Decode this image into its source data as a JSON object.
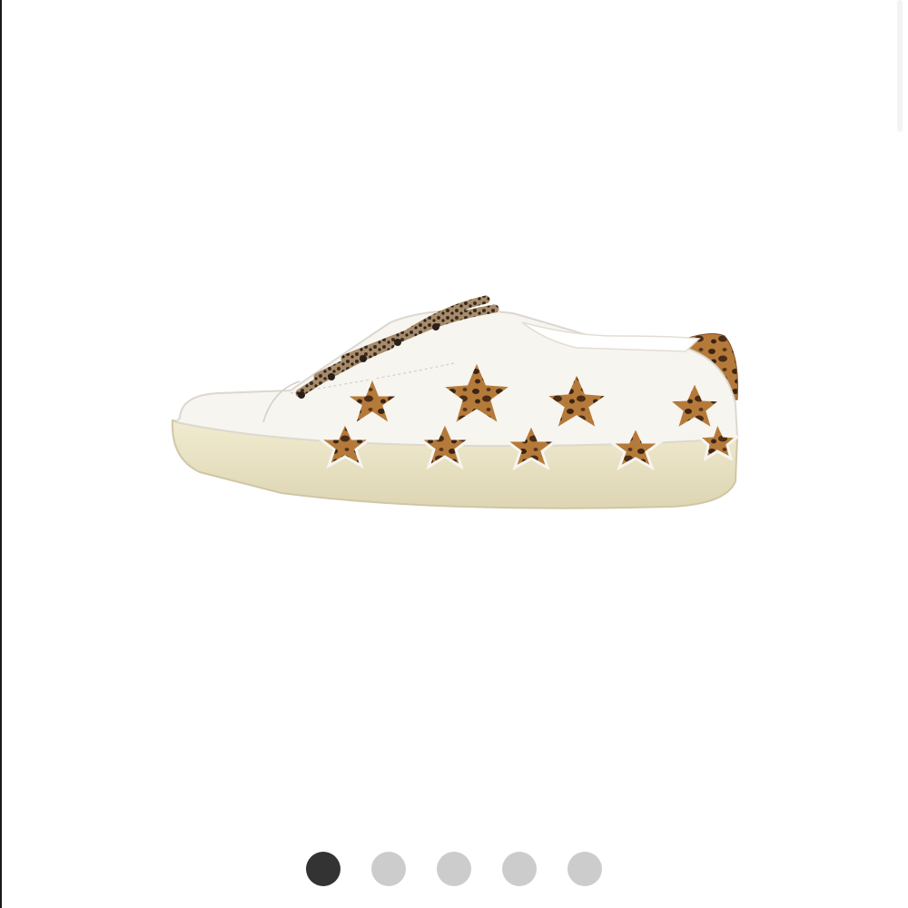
{
  "carousel": {
    "image": {
      "subject": "sneaker",
      "colors": {
        "upper": "#f7f5f0",
        "sole": "#e8e2c4",
        "print_light": "#b57a3a",
        "print_dark": "#3b2414"
      }
    },
    "pagination": {
      "count": 5,
      "active_index": 0,
      "active_color": "#333333",
      "inactive_color": "#cccccc"
    }
  }
}
